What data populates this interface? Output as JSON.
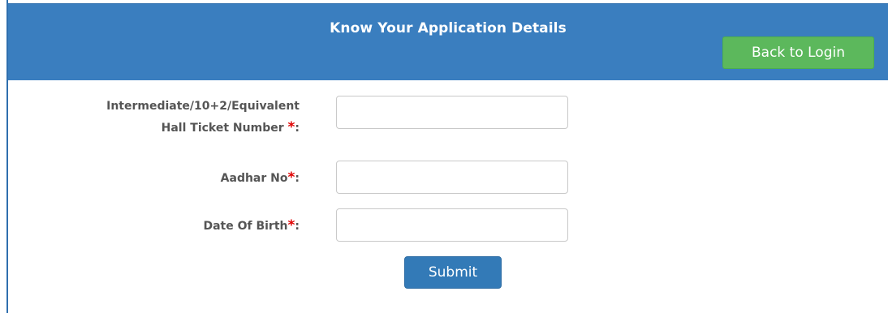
{
  "header": {
    "title": "Know Your Application Details",
    "back_button_label": "Back to Login"
  },
  "form": {
    "hall_ticket": {
      "label_line1": "Intermediate/10+2/Equivalent",
      "label_line2": "Hall Ticket Number ",
      "required_mark": "*",
      "suffix": ":",
      "value": ""
    },
    "aadhar": {
      "label": "Aadhar No",
      "required_mark": "*",
      "suffix": ":",
      "value": ""
    },
    "dob": {
      "label": "Date Of Birth",
      "required_mark": "*",
      "suffix": ":",
      "value": ""
    },
    "submit_label": "Submit"
  },
  "colors": {
    "header_bg": "#3a7ebf",
    "back_button_bg": "#5cb85c",
    "submit_button_bg": "#337ab7",
    "required_mark": "#e00000"
  }
}
